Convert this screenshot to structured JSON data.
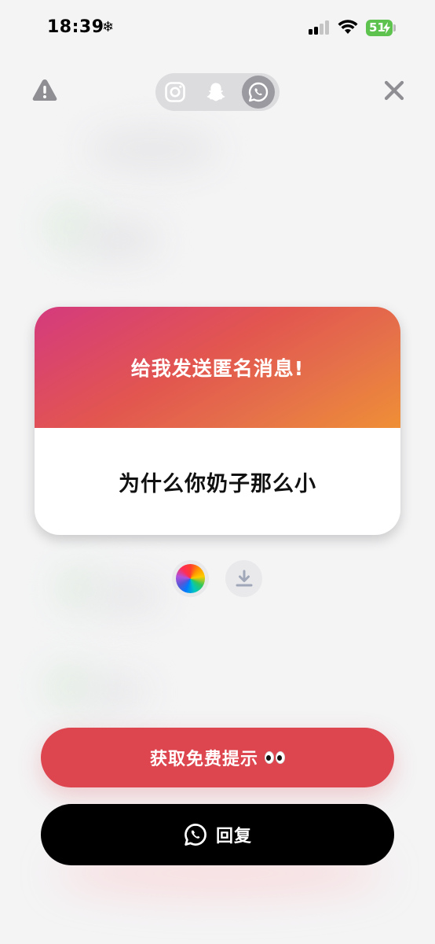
{
  "status_bar": {
    "time": "18:39",
    "battery": "51"
  },
  "top_bar": {
    "platforms": [
      "instagram",
      "snapchat",
      "whatsapp"
    ],
    "selected_platform": "whatsapp"
  },
  "card": {
    "prompt": "给我发送匿名消息!",
    "message": "为什么你奶子那么小"
  },
  "actions": {
    "hint_label": "获取免费提示",
    "reply_label": "回复"
  },
  "colors": {
    "hint_button": "#dd454f",
    "reply_button": "#000000",
    "gradient_start": "#d43a7e",
    "gradient_end": "#ef8f36"
  }
}
